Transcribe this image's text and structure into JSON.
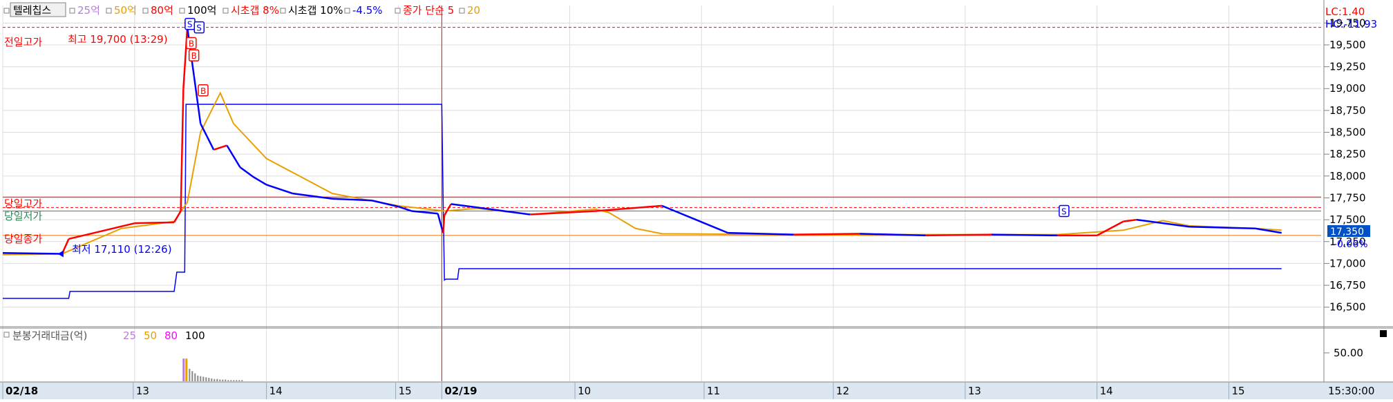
{
  "legend": {
    "items": [
      {
        "label": "텔레칩스",
        "color": "#000000",
        "boxed": true
      },
      {
        "label": "25억",
        "color": "#b57edc"
      },
      {
        "label": "50억",
        "color": "#e8a000"
      },
      {
        "label": "80억",
        "color": "#ff0000"
      },
      {
        "label": "100억",
        "color": "#000000"
      },
      {
        "label": "시초갭 8%",
        "color": "#ff0000"
      },
      {
        "label": "시초갭 10%",
        "color": "#000000"
      },
      {
        "label": "-4.5%",
        "color": "#0000ff"
      },
      {
        "label": "종가 단순 5",
        "color": "#ff0000"
      },
      {
        "label": "20",
        "color": "#e8a000"
      }
    ]
  },
  "volume_legend": {
    "title": "분봉거래대금(억)",
    "items": [
      {
        "label": "25",
        "color": "#b57edc"
      },
      {
        "label": "50",
        "color": "#e8a000"
      },
      {
        "label": "80",
        "color": "#ff00ff"
      },
      {
        "label": "100",
        "color": "#000000"
      }
    ]
  },
  "corner": {
    "lc": "LC:1.40",
    "hc": "HC:-11.93"
  },
  "current": {
    "price": "17,350",
    "change": "-0.06%"
  },
  "annotations": {
    "prev_high_label": "전일고가",
    "high_note": "최고 19,700 (13:29)",
    "low_note": "최저 17,110 (12:26)",
    "day_high_label": "당일고가",
    "day_open_label": "당일시가",
    "day_close_label": "당일종가",
    "open_label": "당일저가",
    "signal_s": "S",
    "signal_b": "B"
  },
  "colors": {
    "up": "#ff0000",
    "down": "#0000ff",
    "ma5": "#ff0000",
    "ma20": "#e8a000",
    "band": "#0000ff",
    "grid": "#dcdcdc",
    "axis_bg": "#dce6f0"
  },
  "chart_data": {
    "type": "line",
    "price_axis": {
      "ticks": [
        "19,750",
        "19,500",
        "19,250",
        "19,000",
        "18,750",
        "18,500",
        "18,250",
        "18,000",
        "17,750",
        "17,500",
        "17,250",
        "17,000",
        "16,750",
        "16,500"
      ],
      "tick_values": [
        19750,
        19500,
        19250,
        19000,
        18750,
        18500,
        18250,
        18000,
        17750,
        17500,
        17250,
        17000,
        16750,
        16500
      ],
      "range": [
        16300,
        19950
      ]
    },
    "volume_axis": {
      "ticks": [
        "50.00"
      ],
      "tick_values": [
        50
      ],
      "range": [
        0,
        90
      ]
    },
    "time_axis": {
      "labels": [
        "02/18",
        "13",
        "14",
        "15",
        "02/19",
        "10",
        "11",
        "12",
        "13",
        "14",
        "15"
      ],
      "bold": [
        true,
        false,
        false,
        false,
        true,
        false,
        false,
        false,
        false,
        false,
        false
      ],
      "time_readout": "15:30:00"
    },
    "levels": {
      "prev_high": 19700,
      "day_high": 17760,
      "open": 17640,
      "day_open": 17600,
      "day_close": 17320
    },
    "price_series": {
      "name": "텔레칩스",
      "x": [
        0.0,
        0.045,
        0.05,
        0.1,
        0.13,
        0.135,
        0.137,
        0.14,
        0.145,
        0.15,
        0.155,
        0.16,
        0.17,
        0.18,
        0.19,
        0.2,
        0.22,
        0.25,
        0.28,
        0.3,
        0.31,
        0.33,
        0.334,
        0.335,
        0.34,
        0.36,
        0.4,
        0.45,
        0.5,
        0.55,
        0.6,
        0.65,
        0.7,
        0.75,
        0.8,
        0.83,
        0.85,
        0.86,
        0.9,
        0.95,
        0.97
      ],
      "y": [
        17120,
        17110,
        17280,
        17460,
        17470,
        17600,
        19000,
        19700,
        19150,
        18600,
        18450,
        18300,
        18350,
        18100,
        17990,
        17900,
        17800,
        17740,
        17720,
        17650,
        17600,
        17570,
        17350,
        17550,
        17680,
        17640,
        17560,
        17600,
        17660,
        17350,
        17330,
        17340,
        17320,
        17330,
        17320,
        17320,
        17480,
        17500,
        17420,
        17400,
        17350
      ]
    },
    "ma20_series": {
      "x": [
        0.0,
        0.045,
        0.09,
        0.13,
        0.14,
        0.15,
        0.165,
        0.175,
        0.2,
        0.25,
        0.3,
        0.335,
        0.36,
        0.4,
        0.45,
        0.46,
        0.48,
        0.5,
        0.6,
        0.8,
        0.85,
        0.88,
        0.9,
        0.95,
        0.97
      ],
      "y": [
        17100,
        17110,
        17400,
        17480,
        17700,
        18500,
        18950,
        18600,
        18200,
        17800,
        17660,
        17600,
        17630,
        17560,
        17620,
        17580,
        17400,
        17340,
        17330,
        17330,
        17380,
        17490,
        17430,
        17400,
        17380
      ]
    },
    "band_series": {
      "x": [
        0.0,
        0.05,
        0.051,
        0.13,
        0.132,
        0.138,
        0.139,
        0.333,
        0.334,
        0.335,
        0.336,
        0.345,
        0.346,
        0.97
      ],
      "y": [
        16600,
        16600,
        16680,
        16680,
        16900,
        16900,
        18820,
        18820,
        17750,
        16810,
        16820,
        16820,
        16940,
        16940
      ]
    },
    "volume": {
      "spike_x": 0.138,
      "spike_value": 40,
      "orange_value": 40,
      "tail": [
        22,
        18,
        14,
        10,
        9,
        8,
        7,
        6,
        5,
        4,
        4,
        3,
        3,
        3,
        2,
        2,
        2,
        2,
        2,
        2
      ]
    }
  }
}
